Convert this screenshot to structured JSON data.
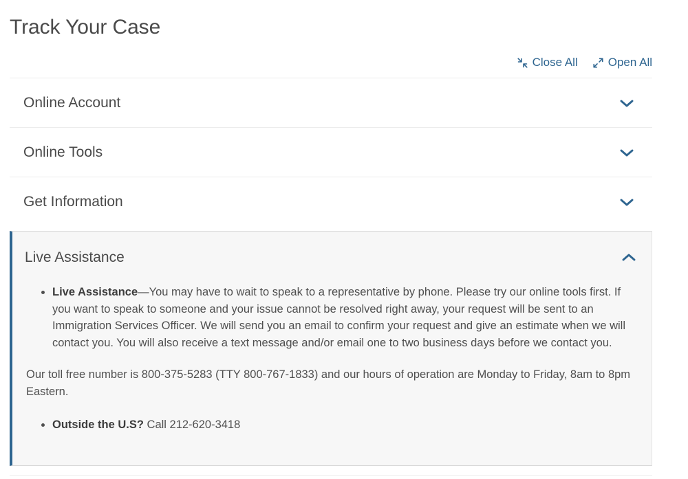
{
  "page": {
    "title": "Track Your Case"
  },
  "toggle_all": {
    "close": {
      "label": "Close All",
      "icon": "collapse-arrows-icon"
    },
    "open": {
      "label": "Open All",
      "icon": "expand-arrows-icon"
    }
  },
  "accordion": {
    "items": [
      {
        "id": "online-account",
        "label": "Online Account",
        "expanded": false,
        "icon": "chevron-down-icon"
      },
      {
        "id": "online-tools",
        "label": "Online Tools",
        "expanded": false,
        "icon": "chevron-down-icon"
      },
      {
        "id": "get-information",
        "label": "Get Information",
        "expanded": false,
        "icon": "chevron-down-icon"
      },
      {
        "id": "live-assistance",
        "label": "Live Assistance",
        "expanded": true,
        "icon": "chevron-up-icon",
        "body": {
          "bullet_1_lead": "Live Assistance",
          "bullet_1_text": "—You may have to wait to speak to a representative by phone. Please try our online tools first. If you want to speak to someone and your issue cannot be resolved right away, your request will be sent to an Immigration Services Officer. We will send you an email to confirm your request and give an estimate when we will contact you. You will also receive a text message and/or email one to two business days before we contact you.",
          "paragraph": "Our toll free number is 800-375-5283 (TTY 800-767-1833) and our hours of operation are Monday to Friday, 8am to 8pm Eastern.",
          "bullet_2_lead": "Outside the U.S?",
          "bullet_2_text": " Call 212-620-3418"
        }
      }
    ]
  },
  "colors": {
    "accent_blue": "#2e6590",
    "link_blue": "#2e6590",
    "heading_gray": "#4a4a4a",
    "body_gray": "#4f4f4f",
    "panel_bg": "#f7f7f7",
    "divider": "#ececec"
  }
}
